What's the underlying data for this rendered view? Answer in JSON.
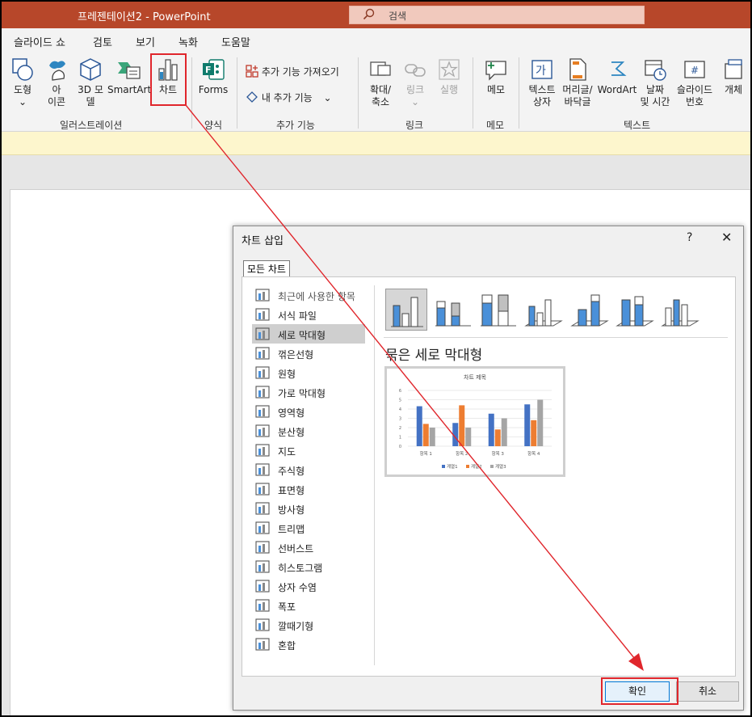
{
  "window": {
    "title": "프레젠테이션2  -  PowerPoint",
    "search_placeholder": "검색"
  },
  "menu": [
    "슬라이드 쇼",
    "검토",
    "보기",
    "녹화",
    "도움말"
  ],
  "ribbon": {
    "shapes": "도형",
    "icons_1": "아",
    "icons_2": "이콘",
    "model3d_1": "3D 모",
    "model3d_2": "델",
    "smartart": "SmartArt",
    "chart": "차트",
    "group_illustrations": "일러스트레이션",
    "forms": "Forms",
    "group_forms": "양식",
    "get_addins": "추가 기능 가져오기",
    "my_addins": "내 추가 기능",
    "group_addins": "추가 기능",
    "zoom_1": "확대/",
    "zoom_2": "축소",
    "link": "링크",
    "action": "실행",
    "group_links": "링크",
    "comment": "메모",
    "group_comments": "메모",
    "textbox_1": "텍스트",
    "textbox_2": "상자",
    "header_1": "머리글/",
    "header_2": "바닥글",
    "wordart": "WordArt",
    "datetime_1": "날짜",
    "datetime_2": "및 시간",
    "slidenum_1": "슬라이드",
    "slidenum_2": "번호",
    "object": "개체",
    "group_text": "텍스트"
  },
  "dialog": {
    "title": "차트 삽입",
    "help": "?",
    "close": "✕",
    "tab": "모든 차트",
    "chart_types": [
      "최근에 사용한 항목",
      "서식 파일",
      "세로 막대형",
      "꺾은선형",
      "원형",
      "가로 막대형",
      "영역형",
      "분산형",
      "지도",
      "주식형",
      "표면형",
      "방사형",
      "트리맵",
      "선버스트",
      "히스토그램",
      "상자 수염",
      "폭포",
      "깔때기형",
      "혼합"
    ],
    "selected_subtype_title": "묶은 세로 막대형",
    "ok": "확인",
    "cancel": "취소"
  },
  "chart_data": {
    "type": "bar",
    "title": "차트 제목",
    "categories": [
      "항목 1",
      "항목 2",
      "항목 3",
      "항목 4"
    ],
    "series": [
      {
        "name": "계열1",
        "values": [
          4.3,
          2.5,
          3.5,
          4.5
        ]
      },
      {
        "name": "계열2",
        "values": [
          2.4,
          4.4,
          1.8,
          2.8
        ]
      },
      {
        "name": "계열3",
        "values": [
          2,
          2,
          3,
          5
        ]
      }
    ],
    "ylim": [
      0,
      6
    ],
    "yticks": [
      "0",
      "1",
      "2",
      "3",
      "4",
      "5",
      "6"
    ],
    "colors": [
      "#4472c4",
      "#ed7d31",
      "#a5a5a5"
    ],
    "grid": true,
    "legend": "bottom"
  }
}
